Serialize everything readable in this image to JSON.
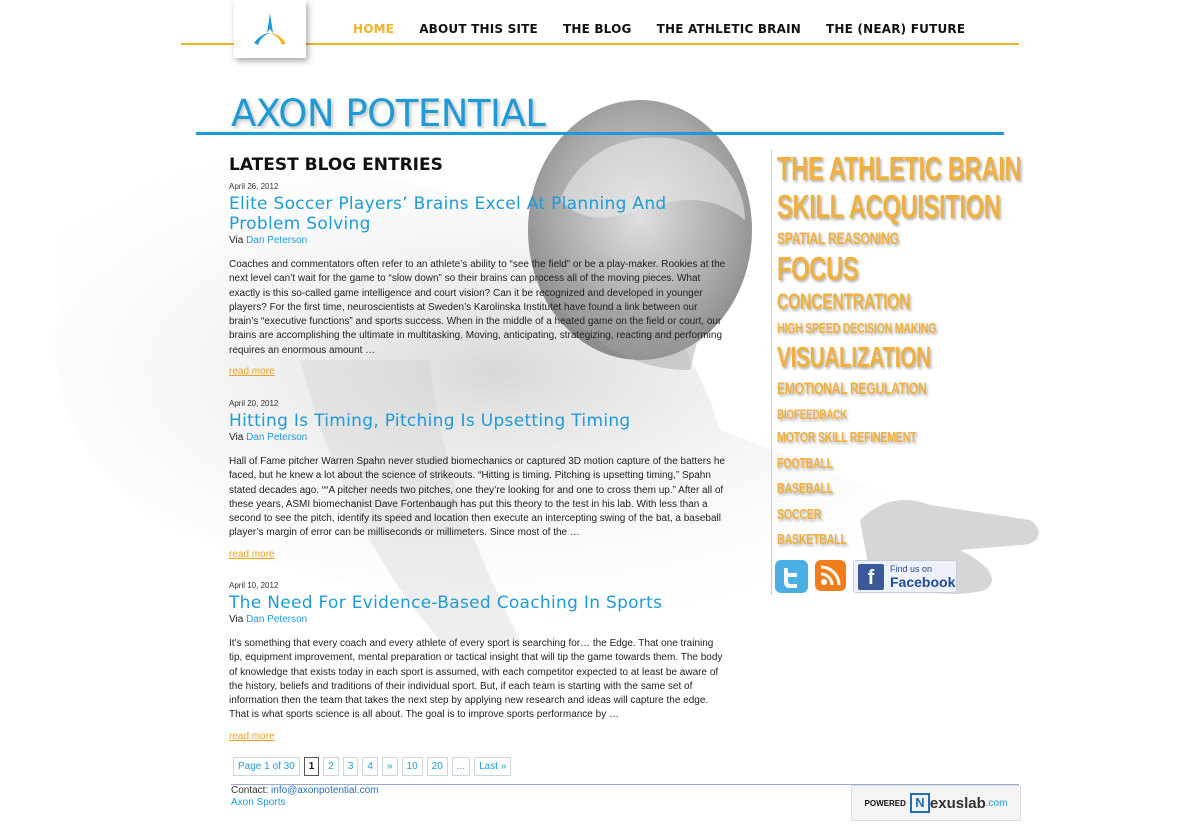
{
  "nav": {
    "items": [
      {
        "label": "HOME",
        "active": true
      },
      {
        "label": "ABOUT THIS SITE"
      },
      {
        "label": "THE BLOG"
      },
      {
        "label": "THE ATHLETIC BRAIN"
      },
      {
        "label": "THE (NEAR) FUTURE"
      }
    ]
  },
  "site": {
    "title": "AXON POTENTIAL"
  },
  "main": {
    "heading": "LATEST BLOG ENTRIES",
    "via_label": "Via",
    "read_more": "read more",
    "posts": [
      {
        "date": "April 26, 2012",
        "title": "Elite Soccer Players’ Brains Excel At Planning And Problem Solving",
        "author": "Dan Peterson",
        "excerpt": "Coaches and commentators often refer to an athlete’s ability to “see the field” or be a play-maker.  Rookies at the next level can’t wait for the game to “slow down” so their brains can process all of the moving pieces.  What exactly is this so-called game intelligence and court vision?  Can it be recognized and developed in younger players?  For the first time, neuroscientists at Sweden’s Karolinska Institutet have found a link between our brain’s “executive functions” and sports success. When in the middle of a heated game on the field or court, our brains are accomplishing the ultimate in multitasking.  Moving, anticipating, strategizing, reacting and performing requires an enormous amount …"
      },
      {
        "date": "April 20, 2012",
        "title": "Hitting Is Timing, Pitching Is Upsetting Timing",
        "author": "Dan Peterson",
        "excerpt": "Hall of Fame pitcher Warren Spahn never studied biomechanics or captured 3D motion capture of the batters he faced, but he knew a lot about the science of strikeouts.  “Hitting is timing.  Pitching is upsetting timing,” Spahn stated decades ago. ““A pitcher needs two pitches, one they’re looking for and one to cross them up.” After all of these years, ASMI biomechanist Dave Fortenbaugh has put this theory to the test in his lab.  With less than a second to see the pitch, identify its speed and location then execute an intercepting swing of the bat, a baseball player’s margin of error can be milliseconds or millimeters.  Since most of the …"
      },
      {
        "date": "April 10, 2012",
        "title": "The Need For Evidence-Based Coaching In Sports",
        "author": "Dan Peterson",
        "excerpt": "It’s something that every coach and every athlete of every sport is searching for… the Edge. That one training tip, equipment improvement, mental preparation or tactical insight that will tip the game towards them. The body of knowledge that exists today in each sport is assumed, with each competitor expected to at least be aware of the history, beliefs and traditions of their individual sport. But, if each team is starting with the same set of information then the team that takes the next step by applying new research and ideas will capture the edge. That is what sports science is all about. The goal is to improve sports performance by …"
      }
    ]
  },
  "pager": {
    "summary": "Page 1 of 30",
    "pages": [
      "1",
      "2",
      "3",
      "4",
      "»",
      "10",
      "20",
      "...",
      "Last »"
    ],
    "current": "1"
  },
  "footer": {
    "contact_label": "Contact:",
    "email": "info@axonpotential.com",
    "org": "Axon Sports",
    "powered_label": "POWERED",
    "powered_n": "N",
    "powered_name": "exuslab",
    "powered_domain": ".com"
  },
  "sidebar": {
    "tags": [
      {
        "label": "THE ATHLETIC BRAIN"
      },
      {
        "label": "SKILL ACQUISITION"
      },
      {
        "label": "SPATIAL REASONING"
      },
      {
        "label": "FOCUS"
      },
      {
        "label": "CONCENTRATION"
      },
      {
        "label": "HIGH SPEED DECISION MAKING"
      },
      {
        "label": "VISUALIZATION"
      },
      {
        "label": "EMOTIONAL REGULATION"
      },
      {
        "label": "BIOFEEDBACK"
      },
      {
        "label": "MOTOR SKILL REFINEMENT"
      },
      {
        "label": "FOOTBALL"
      },
      {
        "label": "BASEBALL"
      },
      {
        "label": "SOCCER"
      },
      {
        "label": "BASKETBALL"
      }
    ],
    "facebook": {
      "line1": "Find us on",
      "line2": "Facebook",
      "letter": "f"
    }
  },
  "colors": {
    "accent_blue": "#1e9bd7",
    "accent_orange": "#f0b040",
    "nav_active": "#f0b429"
  },
  "icons": [
    "logo-icon",
    "twitter-icon",
    "rss-icon",
    "facebook-icon"
  ]
}
